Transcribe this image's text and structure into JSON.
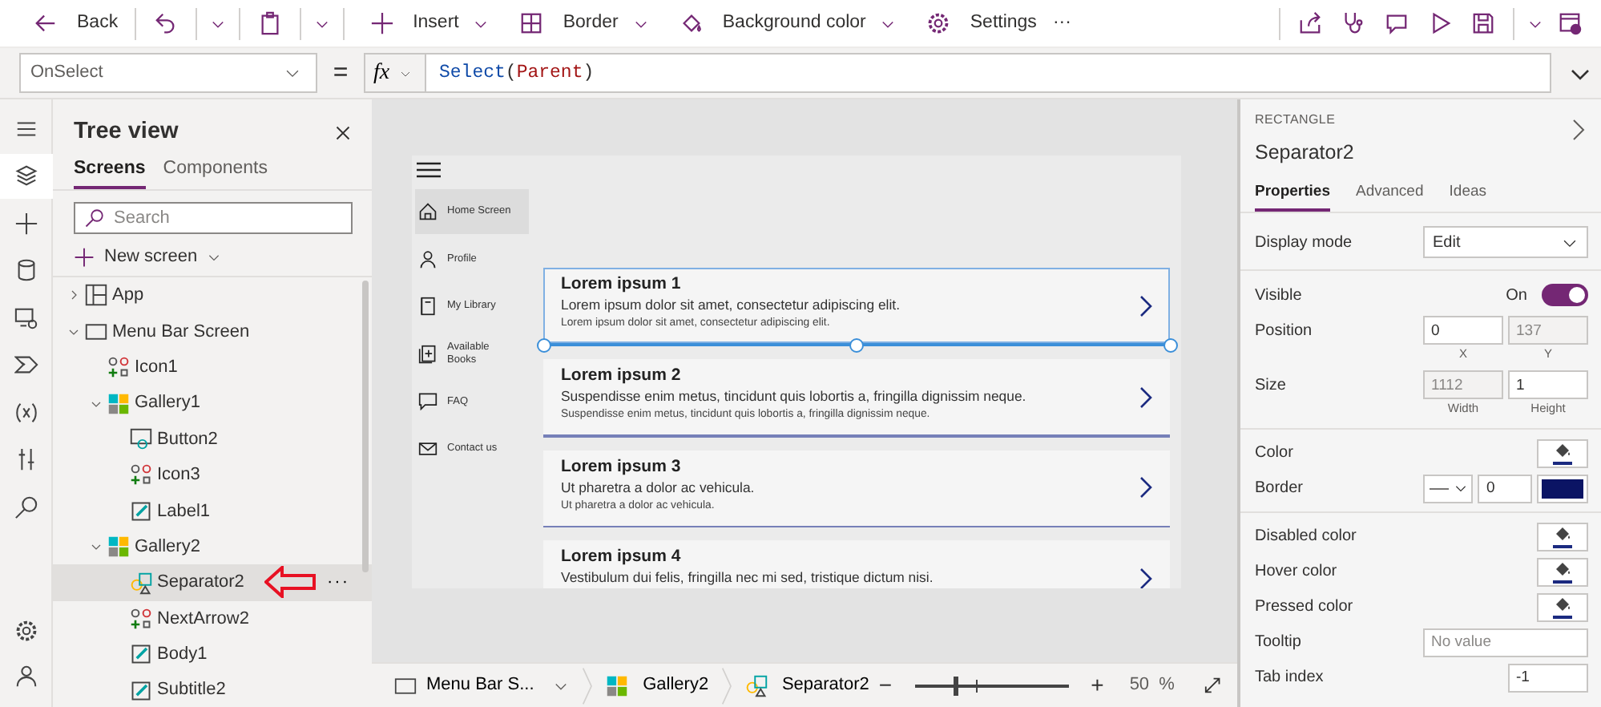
{
  "toolbar": {
    "buttons": [
      {
        "label": "Back"
      },
      {
        "label": "Insert"
      },
      {
        "label": "Border"
      },
      {
        "label": "Background color"
      },
      {
        "label": "Settings"
      }
    ],
    "more": "···"
  },
  "formula_bar": {
    "property": "OnSelect",
    "equals": "=",
    "fx": "fx",
    "tokens": [
      {
        "kind": "function",
        "text": "Select"
      },
      {
        "kind": "punct",
        "text": "("
      },
      {
        "kind": "keyword",
        "text": "Parent"
      },
      {
        "kind": "punct",
        "text": ")"
      }
    ]
  },
  "rail": {
    "items": [
      {
        "selected": true
      },
      {
        "selected": false
      },
      {
        "selected": false
      },
      {
        "selected": false
      },
      {
        "selected": false
      },
      {
        "selected": false
      },
      {
        "selected": false
      },
      {
        "selected": false
      }
    ]
  },
  "tree_view": {
    "title": "Tree view",
    "tabs": [
      {
        "label": "Screens",
        "selected": true
      },
      {
        "label": "Components",
        "selected": false
      }
    ],
    "search_placeholder": "Search",
    "new_screen": "New screen",
    "more": "···",
    "nodes": [
      {
        "kind": "app",
        "label": "App",
        "expanded": false,
        "selected": false
      },
      {
        "kind": "screen",
        "label": "Menu Bar Screen",
        "expanded": true,
        "selected": false,
        "children": [
          {
            "kind": "icon",
            "label": "Icon1",
            "selected": false
          },
          {
            "kind": "gallery",
            "label": "Gallery1",
            "expanded": true,
            "selected": false,
            "children": [
              {
                "kind": "button",
                "label": "Button2",
                "selected": false
              },
              {
                "kind": "icon",
                "label": "Icon3",
                "selected": false
              },
              {
                "kind": "label",
                "label": "Label1",
                "selected": false
              }
            ]
          },
          {
            "kind": "gallery",
            "label": "Gallery2",
            "expanded": true,
            "selected": false,
            "children": [
              {
                "kind": "rectangle",
                "label": "Separator2",
                "selected": true
              },
              {
                "kind": "icon",
                "label": "NextArrow2",
                "selected": false
              },
              {
                "kind": "label",
                "label": "Body1",
                "selected": false
              },
              {
                "kind": "label",
                "label": "Subtitle2",
                "selected": false
              }
            ]
          }
        ]
      }
    ]
  },
  "app_preview": {
    "menu": [
      {
        "label": "Home Screen",
        "selected": true
      },
      {
        "label": "Profile",
        "selected": false
      },
      {
        "label": "My Library",
        "selected": false
      },
      {
        "label": "Available Books",
        "selected": false
      },
      {
        "label": "FAQ",
        "selected": false
      },
      {
        "label": "Contact us",
        "selected": false
      }
    ],
    "gallery": [
      {
        "title": "Lorem ipsum 1",
        "subtitle": "Lorem ipsum dolor sit amet, consectetur adipiscing elit.",
        "body": "Lorem ipsum dolor sit amet, consectetur adipiscing elit.",
        "selected": true
      },
      {
        "title": "Lorem ipsum 2",
        "subtitle": "Suspendisse enim metus, tincidunt quis lobortis a, fringilla dignissim neque.",
        "body": "Suspendisse enim metus, tincidunt quis lobortis a, fringilla dignissim neque.",
        "selected": false
      },
      {
        "title": "Lorem ipsum 3",
        "subtitle": "Ut pharetra a dolor ac vehicula.",
        "body": "Ut pharetra a dolor ac vehicula.",
        "selected": false
      },
      {
        "title": "Lorem ipsum 4",
        "subtitle": "Vestibulum dui felis, fringilla nec mi sed, tristique dictum nisi.",
        "selected": false
      }
    ]
  },
  "properties_panel": {
    "type": "RECTANGLE",
    "name": "Separator2",
    "tabs": [
      {
        "label": "Properties",
        "selected": true
      },
      {
        "label": "Advanced",
        "selected": false
      },
      {
        "label": "Ideas",
        "selected": false
      }
    ],
    "sections": [
      [
        {
          "kind": "dropdown",
          "label": "Display mode",
          "value": "Edit"
        }
      ],
      [
        {
          "kind": "toggle",
          "label": "Visible",
          "state_text": "On",
          "on": true
        },
        {
          "kind": "pair",
          "label": "Position",
          "fields": [
            {
              "value": "0",
              "caption": "X",
              "disabled": false
            },
            {
              "value": "137",
              "caption": "Y",
              "disabled": true
            }
          ]
        },
        {
          "kind": "pair",
          "label": "Size",
          "fields": [
            {
              "value": "1112",
              "caption": "Width",
              "disabled": true
            },
            {
              "value": "1",
              "caption": "Height",
              "disabled": false
            }
          ]
        }
      ],
      [
        {
          "kind": "color",
          "label": "Color",
          "color": "#1b2a80"
        },
        {
          "kind": "border",
          "label": "Border",
          "value": "0",
          "color": "#0b1464"
        }
      ],
      [
        {
          "kind": "color",
          "label": "Disabled color",
          "color": "#1b2a80"
        },
        {
          "kind": "color",
          "label": "Hover color",
          "color": "#1b2a80"
        },
        {
          "kind": "color",
          "label": "Pressed color",
          "color": "#1b2a80"
        },
        {
          "kind": "text",
          "label": "Tooltip",
          "placeholder": "No value"
        },
        {
          "kind": "short_text",
          "label": "Tab index",
          "value": "-1"
        }
      ]
    ]
  },
  "status_bar": {
    "screen": "Menu Bar S...",
    "crumbs": [
      {
        "kind": "gallery",
        "label": "Gallery2"
      },
      {
        "kind": "rectangle",
        "label": "Separator2"
      }
    ],
    "zoom_out": "−",
    "zoom_in": "+",
    "zoom": {
      "level": 0.26
    },
    "zoom_value": "50",
    "percent": "%"
  }
}
